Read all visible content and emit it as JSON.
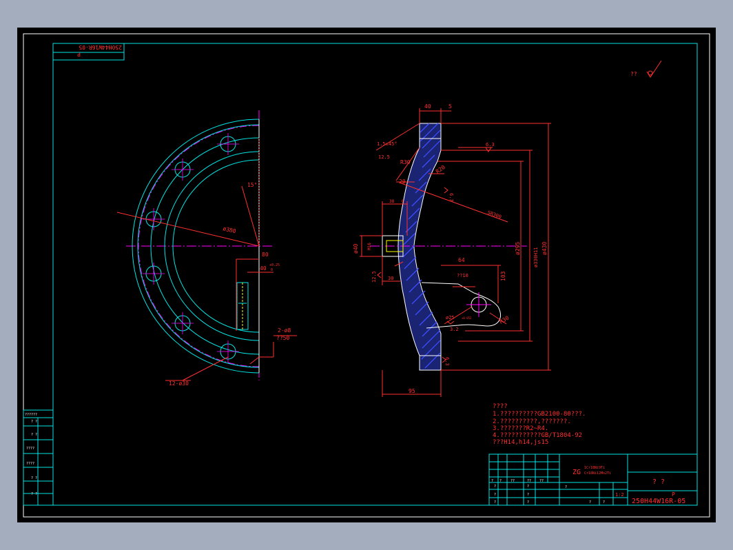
{
  "drawing": {
    "number_mirrored": "250H44W16R-05",
    "sheet_mark": "P",
    "roughness_label": "??",
    "front_view": {
      "bolt_circle_dia": "ø380",
      "angle": "15°",
      "dim_80": "80",
      "dim_40": "40",
      "tol_upper": "+0.25",
      "tol_lower": "0",
      "holes_2": "2-ø8",
      "holes_2_depth": "??50",
      "holes_12": "12-ø30"
    },
    "section_view": {
      "dim_top_40": "40",
      "dim_top_5": "5",
      "chamfer": "1.5x45°",
      "rough_125": "12.5",
      "r30_top": "R30",
      "r20": "R20",
      "dim_20": "20",
      "rough_63": "6.3",
      "rough_63b": "6.3",
      "sr300": "SR300",
      "dim_38": "38",
      "dim_6": "6",
      "d40": "ø40",
      "m16": "M16",
      "dim_30": "30",
      "rough_125b": "12.5",
      "dim_64": "64",
      "dim_103": "103",
      "d295": "ø295",
      "d330": "ø330H11",
      "d430": "ø430",
      "depth_10": "??10",
      "d25": "ø25",
      "d25_tol": "+0.052",
      "rough_32": "3.2",
      "r30_bottom": "R30",
      "rough_63c": "6.3",
      "dim_95": "95"
    },
    "notes": [
      "????",
      "1.??????????GB2100-80???.",
      "2.??????????,???????.",
      "3.???????R2~R4.",
      "4.???????????GB/T1804-92",
      "  ???H14,h14,js15"
    ],
    "title_block": {
      "material_big": "ZG",
      "material_line1": "1Cr18Ni9Ti",
      "material_line2": "Cr18Ni12Mo2Ti",
      "part_name": "? ?",
      "code_p": "P",
      "drawing_no": "250H44W16R-05",
      "scale": "1:2",
      "cells": [
        "?",
        "?",
        "??",
        "??",
        "??",
        "?",
        "?",
        "?",
        "?",
        "?",
        "?",
        "?",
        "?",
        "?"
      ]
    },
    "left_strip": [
      "??????",
      "? ?",
      "? ?",
      "????",
      "????",
      "? ?",
      "? ?"
    ]
  },
  "colors": {
    "background": "#000000",
    "frame": "#00e5e5",
    "dimension": "#ff3030",
    "outline": "#ffffff",
    "centerline": "#ff00ff",
    "hatch": "#3b4dff",
    "hole_line": "#ffff00"
  }
}
